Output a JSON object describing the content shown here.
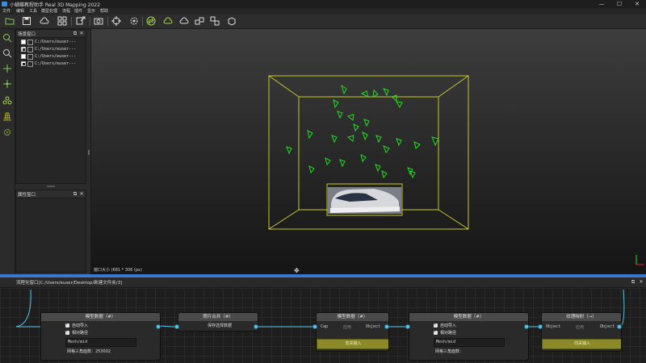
{
  "window": {
    "title": "小蝴蝶教程助手 Real 3D Mapping 2022",
    "controls": [
      "—",
      "☐",
      "✕"
    ]
  },
  "menu": [
    "文件",
    "编辑",
    "工具",
    "模型处理",
    "流程",
    "插件",
    "显示",
    "帮助"
  ],
  "toolbar": {
    "icons": [
      "open-folder-icon",
      "save-icon",
      "cloud-import-icon",
      "image-grid-icon",
      "share-icon",
      "camera-icon",
      "target-icon",
      "gear-refresh-icon",
      "swap-icon",
      "cloud-icon",
      "cubes-icon",
      "cubes-link-icon",
      "box-icon",
      "mesh-box-icon"
    ]
  },
  "left_tools": [
    "search-icon",
    "zoom-icon",
    "move-icon",
    "align-icon",
    "link-points-icon",
    "grid-cube-icon",
    "sphere-icon"
  ],
  "scene_panel": {
    "title": "场景窗口",
    "items": [
      {
        "label": "C:/Users/euser---",
        "checked": false
      },
      {
        "label": "C:/Users/euser---",
        "checked": true
      },
      {
        "label": "C:/Users/euser---",
        "checked": false
      },
      {
        "label": "C:/Users/euser---",
        "checked": true
      }
    ]
  },
  "properties_panel": {
    "title": "属性窗口"
  },
  "viewport": {
    "status": "窗口大小 (681 * 306 (px)"
  },
  "graph": {
    "header": "流程化窗口[C:/Users/euser/Desktop/新建文件夹/3]",
    "nodes": {
      "model1": {
        "title": "模型数据（#）",
        "opt1": "自动导入",
        "opt2": "相对路径",
        "field": "Mesh/mid",
        "info": "网格三角面数：253002"
      },
      "photos": {
        "title": "照片合并（#）",
        "sub": "保存选择数据"
      },
      "model2": {
        "title": "模型数据（#）",
        "in_label": "Cap",
        "mid_label": "应用",
        "out_label": "Object",
        "button": "向关输入"
      },
      "model3": {
        "title": "模型数据（#）",
        "opt1": "自动导入",
        "opt2": "相对路径",
        "field": "Mesh/mid",
        "info": "网格三角面数："
      },
      "texture": {
        "title": "纹理映射（→）",
        "in_label": "Object",
        "mid_label": "应用",
        "out_label": "Object",
        "button": "向关输入"
      }
    }
  },
  "colors": {
    "accent_blue": "#3a78d0",
    "camera_green": "#22dd22",
    "bbox_yellow": "#c8c828",
    "wire_blue": "#5bc4ea"
  }
}
